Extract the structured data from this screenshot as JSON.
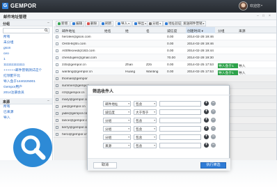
{
  "app": {
    "logo_letter": "G",
    "brand": "GEMPOR",
    "username": "欢迎您",
    "caret": "▾"
  },
  "subbar": {
    "title": "邮件地址管理",
    "icons": [
      "–",
      "□",
      "×"
    ]
  },
  "sidebar": {
    "section1": "分组",
    "collapse": "−",
    "search_placeholder": "",
    "items1": [
      "所有",
      "未分组",
      "gson",
      "ceo",
      "1",
      "1111111111111",
      "++++++邮件营销测试这个",
      "红领配干比",
      "导入鱼于1440225001",
      "Gempor用户",
      "2014注册会员"
    ],
    "section2": "来源",
    "items2": [
      "所有",
      "已来源",
      "导入"
    ]
  },
  "toolbar": {
    "buttons": [
      "新增",
      "编辑",
      "删除",
      "刷新",
      "导入",
      "导出",
      "分组",
      "地址验证",
      "发送邮件营销"
    ]
  },
  "table": {
    "headers": [
      "邮件地址",
      "姓名",
      "姓",
      "名",
      "诚信度",
      "创建时间",
      "分组",
      "来源"
    ],
    "rows": [
      {
        "email": "herolee@gson.com",
        "name": "",
        "last": "",
        "first": "",
        "score": "0.00",
        "created": "2014-02-28 19:46",
        "group": "",
        "source": ""
      },
      {
        "email": "OHSHI@tn.com",
        "name": "",
        "last": "",
        "first": "",
        "score": "0.00",
        "created": "2014-02-28 19:46",
        "group": "",
        "source": ""
      },
      {
        "email": "A00ffeceed@163.com",
        "name": "",
        "last": "",
        "first": "",
        "score": "0.00",
        "created": "2014-02-28 19:44",
        "group": "",
        "source": ""
      },
      {
        "email": "chendujien@gmail.com",
        "name": "",
        "last": "",
        "first": "",
        "score": "70.00",
        "created": "2014-02-28 19:30",
        "group": "",
        "source": ""
      },
      {
        "email": "zzb@gempor.cn",
        "name": "",
        "last": "Zhan",
        "first": "Zzb",
        "score": "0.00",
        "created": "2014-02-25 17:53",
        "group": "导入鱼于1",
        "source": "导入"
      },
      {
        "email": "wanting@gempor.cn",
        "name": "",
        "last": "Huang",
        "first": "Wanting",
        "score": "0.00",
        "created": "2014-02-25 17:53",
        "group": "导入鱼于1",
        "source": "导入"
      },
      {
        "email": "thomas@gempor",
        "name": "",
        "last": "",
        "first": "",
        "score": "",
        "created": "",
        "group": "",
        "source": ""
      },
      {
        "email": "summer@gempor",
        "name": "",
        "last": "",
        "first": "",
        "score": "",
        "created": "",
        "group": "",
        "source": ""
      },
      {
        "email": "rcf@gempor.cn",
        "name": "",
        "last": "",
        "first": "",
        "score": "",
        "created": "",
        "group": "",
        "source": ""
      },
      {
        "email": "mary@gempor.cn",
        "name": "",
        "last": "",
        "first": "",
        "score": "",
        "created": "",
        "group": "",
        "source": ""
      },
      {
        "email": "joe@gempor.cn",
        "name": "",
        "last": "",
        "first": "",
        "score": "",
        "created": "",
        "group": "",
        "source": ""
      },
      {
        "email": "jade@gempor.cn",
        "name": "",
        "last": "",
        "first": "",
        "score": "",
        "created": "",
        "group": "",
        "source": ""
      },
      {
        "email": "lance@gempor.cn",
        "name": "",
        "last": "",
        "first": "",
        "score": "",
        "created": "",
        "group": "",
        "source": ""
      },
      {
        "email": "kerry@gempor.cn",
        "name": "",
        "last": "",
        "first": "",
        "score": "",
        "created": "",
        "group": "",
        "source": ""
      },
      {
        "email": "hero@gempor.cn",
        "name": "",
        "last": "",
        "first": "",
        "score": "",
        "created": "",
        "group": "",
        "source": ""
      }
    ]
  },
  "dialog": {
    "title": "筛选收件人",
    "rows": [
      {
        "field": "邮件地址",
        "op": "包含",
        "value": ""
      },
      {
        "field": "诚信度",
        "op": "大于等于",
        "value": ""
      },
      {
        "field": "分组",
        "op": "包含",
        "value": ""
      },
      {
        "field": "分组",
        "op": "包含",
        "value": ""
      },
      {
        "field": "分组",
        "op": "包含",
        "value": ""
      },
      {
        "field": "来源",
        "op": "包含",
        "value": ""
      }
    ],
    "plus": "+",
    "minus": "−",
    "cancel": "取消",
    "run": "执行筛选"
  },
  "colors": {
    "titlebar": "#2b3036",
    "accent": "#2e7bd6",
    "link": "#1b62c4",
    "tag": "#2da24a",
    "badge": "#2d8ad6"
  }
}
